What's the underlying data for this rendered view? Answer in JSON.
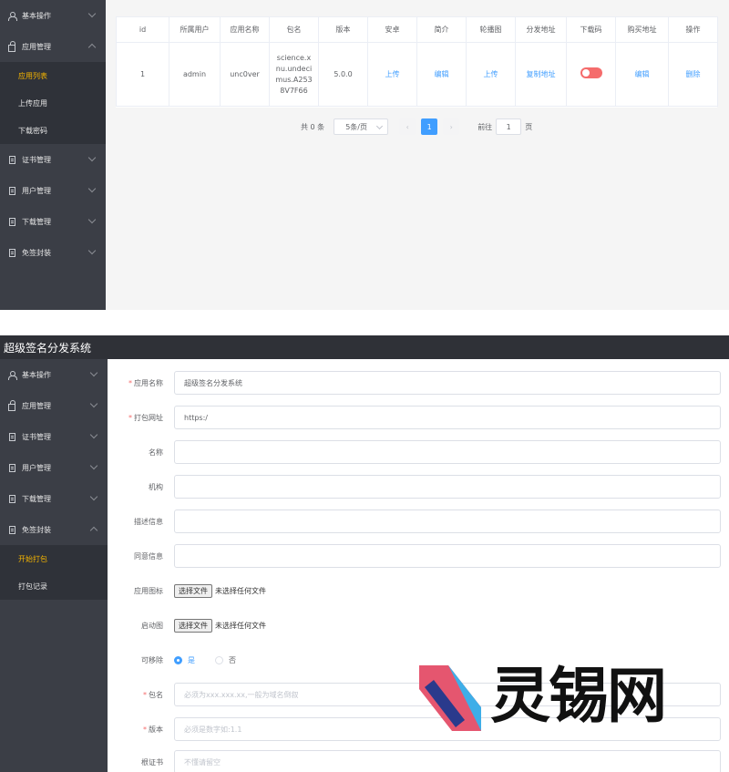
{
  "list_view": {
    "sidebar": [
      {
        "label": "基本操作",
        "icon": "user-icon",
        "expanded": false
      },
      {
        "label": "应用管理",
        "icon": "lock-icon",
        "expanded": true,
        "children": [
          {
            "label": "应用列表",
            "active": true
          },
          {
            "label": "上传应用",
            "active": false
          },
          {
            "label": "下载密码",
            "active": false
          }
        ]
      },
      {
        "label": "证书管理",
        "icon": "document-icon",
        "expanded": false
      },
      {
        "label": "用户管理",
        "icon": "document-icon",
        "expanded": false
      },
      {
        "label": "下载管理",
        "icon": "document-icon",
        "expanded": false
      },
      {
        "label": "免签封装",
        "icon": "document-icon",
        "expanded": false
      }
    ],
    "table": {
      "headers": [
        "id",
        "所属用户",
        "应用名称",
        "包名",
        "版本",
        "安卓",
        "简介",
        "轮播图",
        "分发地址",
        "下载码",
        "购买地址",
        "操作"
      ],
      "rows": [
        {
          "id": "1",
          "user": "admin",
          "app_name": "unc0ver",
          "package": "science.xnu.undecimus.A2538V7F66",
          "version": "5.0.0",
          "android": "上传",
          "intro": "编辑",
          "carousel": "上传",
          "dist_url": "复制地址",
          "download_code_on": false,
          "buy_url": "编辑",
          "action": "删除"
        }
      ]
    },
    "pagination": {
      "total_label": "共 0 条",
      "page_size": "5条/页",
      "current_page": "1",
      "goto_label": "前往",
      "goto_value": "1",
      "page_suffix": "页",
      "prev": "‹",
      "next": "›"
    }
  },
  "form_view": {
    "title": "超级签名分发系统",
    "sidebar": [
      {
        "label": "基本操作",
        "icon": "user-icon",
        "expanded": false
      },
      {
        "label": "应用管理",
        "icon": "lock-icon",
        "expanded": false
      },
      {
        "label": "证书管理",
        "icon": "document-icon",
        "expanded": false
      },
      {
        "label": "用户管理",
        "icon": "document-icon",
        "expanded": false
      },
      {
        "label": "下载管理",
        "icon": "document-icon",
        "expanded": false
      },
      {
        "label": "免签封装",
        "icon": "document-icon",
        "expanded": true,
        "children": [
          {
            "label": "开始打包",
            "active": true
          },
          {
            "label": "打包记录",
            "active": false
          }
        ]
      }
    ],
    "fields": {
      "app_name": {
        "label": "应用名称",
        "required": true,
        "value": "超级签名分发系统"
      },
      "pack_url": {
        "label": "打包网址",
        "required": true,
        "value": "https:/"
      },
      "name": {
        "label": "名称",
        "required": false,
        "value": ""
      },
      "org": {
        "label": "机构",
        "required": false,
        "value": ""
      },
      "desc": {
        "label": "描述信息",
        "required": false,
        "value": ""
      },
      "agree": {
        "label": "同意信息",
        "required": false,
        "value": ""
      },
      "app_icon": {
        "label": "应用图标",
        "button": "选择文件",
        "status": "未选择任何文件"
      },
      "launch": {
        "label": "启动图",
        "button": "选择文件",
        "status": "未选择任何文件"
      },
      "removable": {
        "label": "可移除",
        "options": [
          "是",
          "否"
        ],
        "selected": "是"
      },
      "package": {
        "label": "包名",
        "required": true,
        "placeholder": "必须为xxx.xxx.xx,一般为域名倒叙"
      },
      "version": {
        "label": "版本",
        "required": true,
        "placeholder": "必须是数字如:1.1"
      },
      "cert": {
        "label": "根证书",
        "required": false,
        "placeholder": "不懂请留空"
      }
    }
  },
  "watermark": {
    "text": "灵锡网",
    "colors": {
      "pink": "#e5566f",
      "blue": "#3eaee8",
      "navy": "#2a3a8c"
    }
  },
  "colors": {
    "sidebar": "#3b3e46",
    "submenu": "#2f3239",
    "active": "#f4b400",
    "link": "#409eff",
    "danger": "#f56c6c"
  }
}
